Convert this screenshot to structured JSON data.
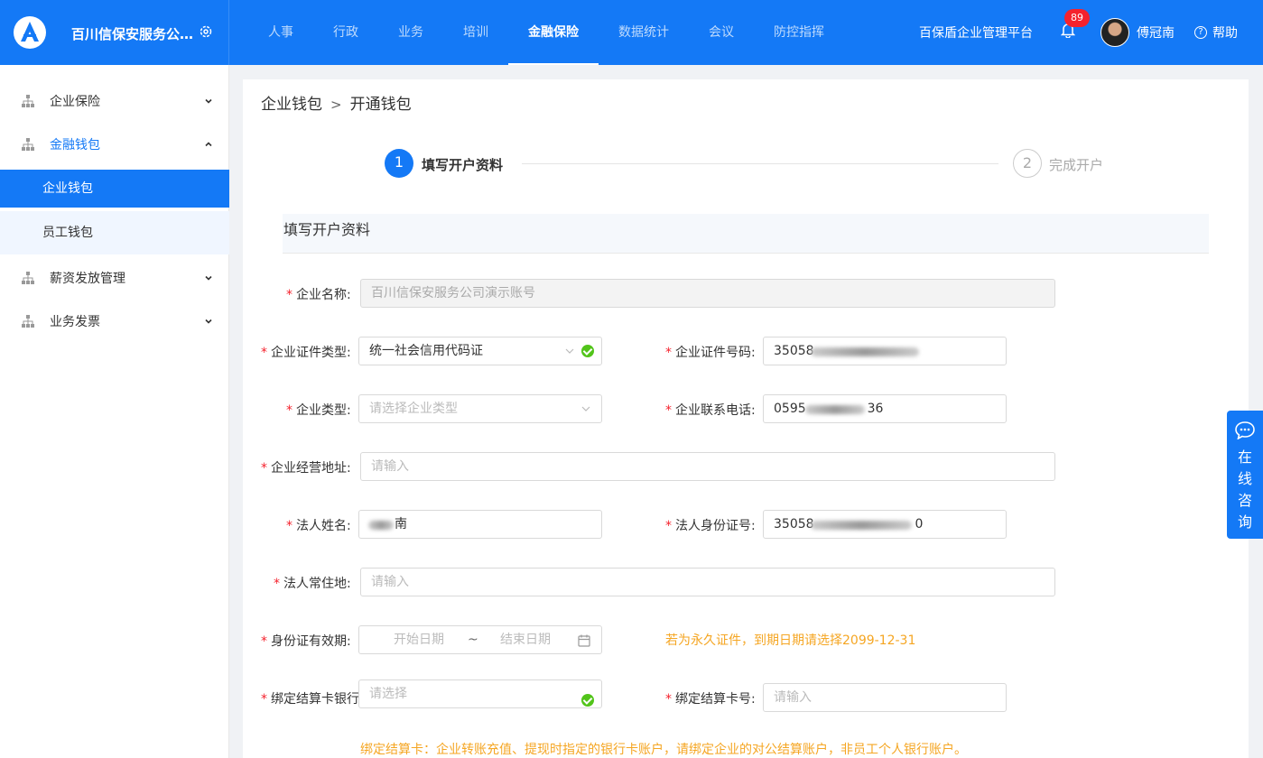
{
  "brand": {
    "name": "百川信保安服务公司演示账号"
  },
  "nav": [
    "人事",
    "行政",
    "业务",
    "培训",
    "金融保险",
    "数据统计",
    "会议",
    "防控指挥"
  ],
  "nav_active": "金融保险",
  "platform_name": "百保盾企业管理平台",
  "notifications": "89",
  "user_name": "傅冠南",
  "help_label": "帮助",
  "sidebar": {
    "groups": [
      "企业保险",
      "金融钱包",
      "薪资发放管理",
      "业务发票"
    ],
    "sub_items": [
      "企业钱包",
      "员工钱包"
    ]
  },
  "breadcrumb": {
    "parent": "企业钱包",
    "sep": ">",
    "current": "开通钱包"
  },
  "steps": [
    {
      "num": "1",
      "label": "填写开户资料"
    },
    {
      "num": "2",
      "label": "完成开户"
    }
  ],
  "section_title": "填写开户资料",
  "form": {
    "company_name_label": "企业名称:",
    "company_name_value": "百川信保安服务公司演示账号",
    "cert_type_label": "企业证件类型:",
    "cert_type_value": "统一社会信用代码证",
    "cert_no_label": "企业证件号码:",
    "cert_no_value": "35058",
    "company_type_label": "企业类型:",
    "company_type_placeholder": "请选择企业类型",
    "phone_label": "企业联系电话:",
    "phone_value": "0595",
    "phone_value_tail": "36",
    "address_label": "企业经营地址:",
    "address_placeholder": "请输入",
    "legal_name_label": "法人姓名:",
    "legal_name_value": "南",
    "legal_id_label": "法人身份证号:",
    "legal_id_value": "35058",
    "legal_id_tail": "0",
    "residence_label": "法人常住地:",
    "residence_placeholder": "请输入",
    "id_valid_label": "身份证有效期:",
    "start_placeholder": "开始日期",
    "range_sep": "~",
    "end_placeholder": "结束日期",
    "id_hint": "若为永久证件，到期日期请选择2099-12-31",
    "bank_label": "绑定结算卡银行:",
    "bank_placeholder": "请选择",
    "card_no_label": "绑定结算卡号:",
    "card_no_placeholder": "请输入",
    "card_hint": "绑定结算卡：企业转账充值、提现时指定的银行卡账户，请绑定企业的对公结算账户，非员工个人银行账户。"
  },
  "float_service": {
    "label": "在线咨询"
  },
  "colors": {
    "primary": "#1479f6",
    "warning": "#f5a623",
    "success": "#52c41a",
    "required": "#f5222d"
  }
}
